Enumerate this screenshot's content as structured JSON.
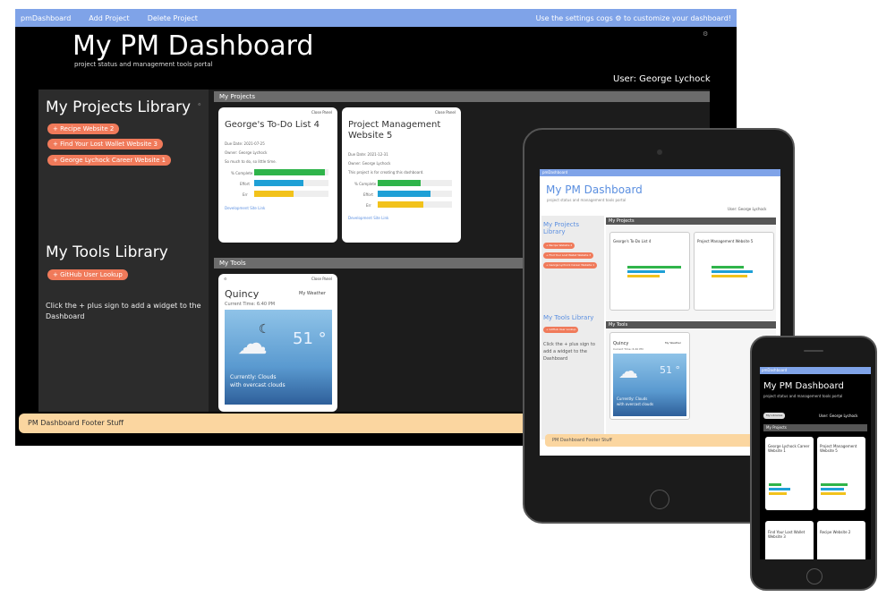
{
  "desktop": {
    "nav": {
      "brand": "pmDashboard",
      "add": "Add Project",
      "delete": "Delete Project",
      "hint": "Use the settings cogs ⚙ to customize your dashboard!"
    },
    "title": "My PM Dashboard",
    "subtitle": "project status and management tools portal",
    "user": "User: George Lychock",
    "projects_library": {
      "title": "My Projects Library",
      "items": [
        "+ Recipe Website 2",
        "+ Find Your Lost Wallet Website 3",
        "+ George Lychock Career Website 1"
      ]
    },
    "tools_library": {
      "title": "My Tools Library",
      "items": [
        "+ GitHub User Lookup"
      ],
      "help": "Click the + plus sign to add a widget to the Dashboard"
    },
    "my_projects_label": "My Projects",
    "my_tools_label": "My Tools",
    "cards": [
      {
        "close": "Close Panel",
        "title": "George's To-Do List 4",
        "due": "Due Date: 2021-07-25",
        "owner": "Owner: George Lychock",
        "desc": "So much to do, so little time.",
        "bars": [
          {
            "label": "% Complete",
            "pct": 0.95,
            "color": "#2fb44a"
          },
          {
            "label": "Effort",
            "pct": 0.66,
            "color": "#1fa0d6"
          },
          {
            "label": "Err",
            "pct": 0.53,
            "color": "#f2c21b"
          }
        ],
        "link": "Development Site Link"
      },
      {
        "close": "Close Panel",
        "title": "Project Management Website 5",
        "due": "Due Date: 2021-12-31",
        "owner": "Owner: George Lychock",
        "desc": "This project is for creating this dashboard.",
        "bars": [
          {
            "label": "% Complete",
            "pct": 0.58,
            "color": "#2fb44a"
          },
          {
            "label": "Effort",
            "pct": 0.71,
            "color": "#1fa0d6"
          },
          {
            "label": "Err",
            "pct": 0.62,
            "color": "#f2c21b"
          }
        ],
        "link": "Development Site Link"
      }
    ],
    "weather": {
      "close": "Close Panel",
      "city": "Quincy",
      "widget": "My Weather",
      "time": "Current Time: 6:40 PM",
      "temp": "51 °",
      "cond1": "Currently: Clouds",
      "cond2": "with overcast clouds"
    },
    "footer": "PM Dashboard Footer Stuff"
  },
  "tablet": {
    "brand": "pmDashboard",
    "title": "My PM Dashboard",
    "subtitle": "project status and management tools portal",
    "user": "User: George Lychock",
    "projects_library": "My Projects Library",
    "projects": [
      "+ Recipe Website 2",
      "+ Find Your Lost Wallet Website 3",
      "+ George Lychock Career Website 1"
    ],
    "tools_library": "My Tools Library",
    "tools": [
      "+ GitHub User Lookup"
    ],
    "help": "Click the + plus sign to add a widget to the Dashboard",
    "my_projects": "My Projects",
    "my_tools": "My Tools",
    "card1": "George's To-Do List 4",
    "card2": "Project Management Website 5",
    "weather_city": "Quincy",
    "weather_widget": "My Weather",
    "weather_time": "Current Time: 6:40 PM",
    "weather_temp": "51 °",
    "weather_cond1": "Currently: Clouds",
    "weather_cond2": "with overcast clouds",
    "footer": "PM Dashboard Footer Stuff"
  },
  "phone": {
    "brand": "pmDashboard",
    "title": "My PM Dashboard",
    "subtitle": "project status and management tools portal",
    "libraries": "My Libraries",
    "user": "User: George Lychock",
    "my_projects": "My Projects",
    "card1": "George Lychock Career Website 1",
    "card2": "Project Management Website 5",
    "card3": "Find Your Lost Wallet Website 3",
    "card4": "Recipe Website 2"
  }
}
